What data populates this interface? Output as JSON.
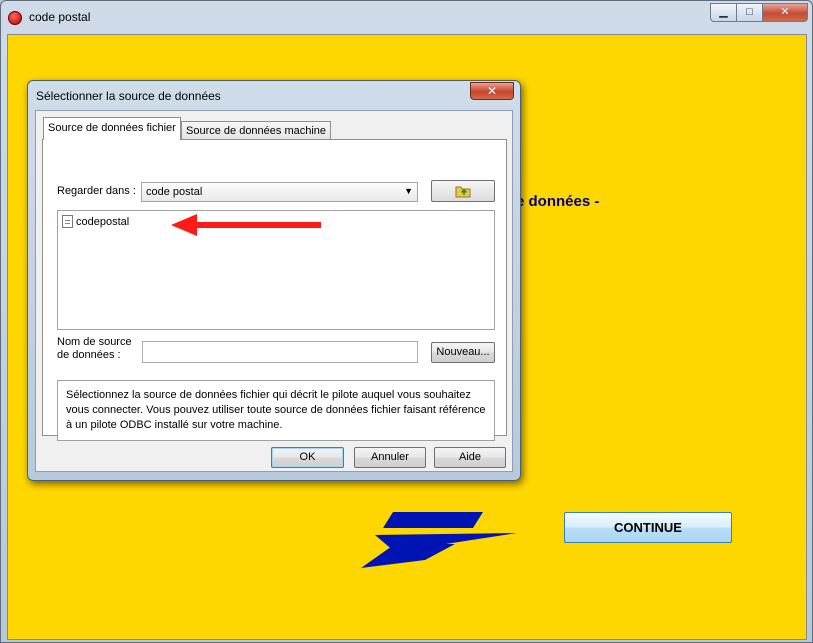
{
  "window": {
    "title": "code postal",
    "min_glyph": "▁",
    "max_glyph": "□",
    "close_glyph": "✕",
    "app_icon": "app-red-circle-icon"
  },
  "background": {
    "partial_text": "e données -",
    "continue_label": "CONTINUE",
    "colors": {
      "background": "#FFD700",
      "text": "#00008B",
      "logo": "#0014B4"
    }
  },
  "dialog": {
    "title": "Sélectionner la source de données",
    "close_glyph": "✕",
    "tabs": [
      {
        "label": "Source de données fichier",
        "active": true
      },
      {
        "label": "Source de données machine",
        "active": false
      }
    ],
    "look_in_label": "Regarder dans :",
    "look_in_value": "code postal",
    "files": [
      {
        "name": "codepostal",
        "icon": "file-dsn-icon"
      }
    ],
    "name_label_line1": "Nom de source",
    "name_label_line2": "de données :",
    "name_value": "",
    "new_button": "Nouveau...",
    "description": "Sélectionnez la source de données fichier qui décrit le pilote auquel vous souhaitez vous connecter. Vous pouvez utiliser toute source de données fichier faisant référence à un pilote ODBC installé sur votre machine.",
    "ok_button": "OK",
    "cancel_button": "Annuler",
    "help_button": "Aide"
  }
}
